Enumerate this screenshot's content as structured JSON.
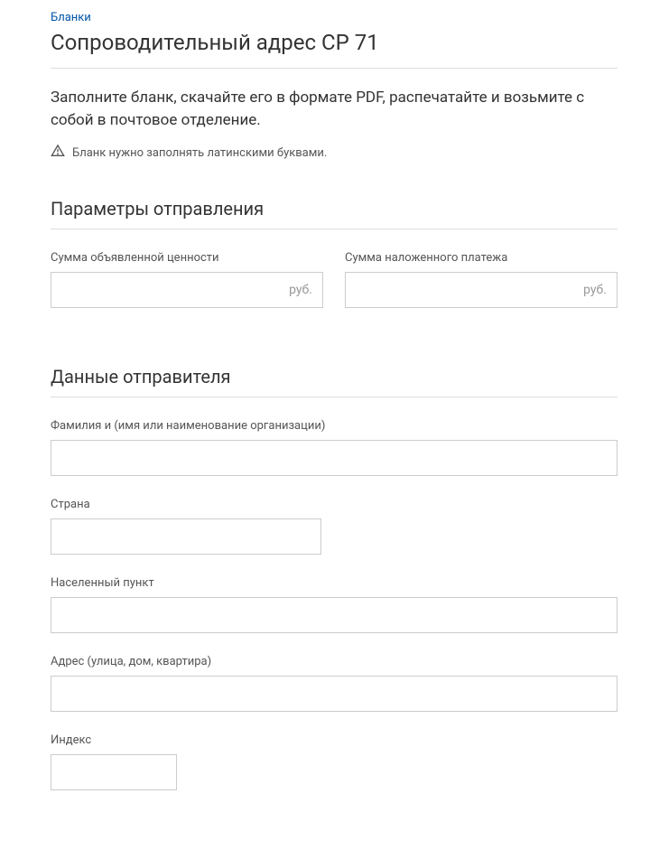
{
  "breadcrumb": {
    "label": "Бланки"
  },
  "title": "Сопроводительный адрес CP 71",
  "instructions": "Заполните бланк, скачайте его в формате PDF, распечатайте и возьмите с собой в почтовое отделение.",
  "notice": {
    "icon": "warning-icon",
    "text": "Бланк нужно заполнять латинскими буквами."
  },
  "sections": {
    "shipping": {
      "title": "Параметры отправления",
      "fields": {
        "declared_value": {
          "label": "Сумма объявленной ценности",
          "suffix": "руб.",
          "value": ""
        },
        "cod": {
          "label": "Сумма наложенного платежа",
          "suffix": "руб.",
          "value": ""
        }
      }
    },
    "sender": {
      "title": "Данные отправителя",
      "fields": {
        "name": {
          "label": "Фамилия и (имя или наименование организации)",
          "value": ""
        },
        "country": {
          "label": "Страна",
          "value": ""
        },
        "city": {
          "label": "Населенный пункт",
          "value": ""
        },
        "address": {
          "label": "Адрес (улица, дом, квартира)",
          "value": ""
        },
        "index": {
          "label": "Индекс",
          "value": ""
        }
      }
    }
  }
}
